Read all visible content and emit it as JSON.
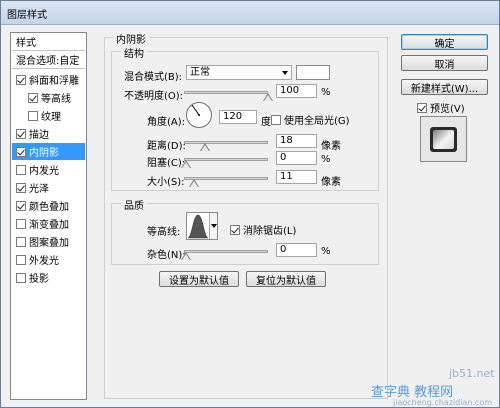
{
  "window": {
    "title": "图层样式"
  },
  "left_panel": {
    "header": "样式",
    "blend_options": "混合选项:自定",
    "items": [
      {
        "label": "斜面和浮雕",
        "checked": true,
        "indent": false,
        "selected": false
      },
      {
        "label": "等高线",
        "checked": true,
        "indent": true,
        "selected": false
      },
      {
        "label": "纹理",
        "checked": false,
        "indent": true,
        "selected": false
      },
      {
        "label": "描边",
        "checked": true,
        "indent": false,
        "selected": false
      },
      {
        "label": "内阴影",
        "checked": true,
        "indent": false,
        "selected": true
      },
      {
        "label": "内发光",
        "checked": false,
        "indent": false,
        "selected": false
      },
      {
        "label": "光泽",
        "checked": true,
        "indent": false,
        "selected": false
      },
      {
        "label": "颜色叠加",
        "checked": true,
        "indent": false,
        "selected": false
      },
      {
        "label": "渐变叠加",
        "checked": false,
        "indent": false,
        "selected": false
      },
      {
        "label": "图案叠加",
        "checked": false,
        "indent": false,
        "selected": false
      },
      {
        "label": "外发光",
        "checked": false,
        "indent": false,
        "selected": false
      },
      {
        "label": "投影",
        "checked": false,
        "indent": false,
        "selected": false
      }
    ]
  },
  "inner_shadow": {
    "title": "内阴影",
    "structure": {
      "title": "结构",
      "blend_mode_label": "混合模式(B):",
      "blend_mode_value": "正常",
      "opacity_label": "不透明度(O):",
      "opacity_value": "100",
      "opacity_unit": "%",
      "angle_label": "角度(A):",
      "angle_value": "120",
      "angle_unit": "度",
      "global_light_label": "使用全局光(G)",
      "global_light_checked": false,
      "distance_label": "距离(D):",
      "distance_value": "18",
      "distance_unit": "像素",
      "choke_label": "阻塞(C):",
      "choke_value": "0",
      "choke_unit": "%",
      "size_label": "大小(S):",
      "size_value": "11",
      "size_unit": "像素"
    },
    "quality": {
      "title": "品质",
      "contour_label": "等高线:",
      "anti_alias_label": "消除锯齿(L)",
      "anti_alias_checked": true,
      "noise_label": "杂色(N):",
      "noise_value": "0",
      "noise_unit": "%"
    },
    "set_default_label": "设置为默认值",
    "reset_default_label": "复位为默认值"
  },
  "buttons": {
    "ok": "确定",
    "cancel": "取消",
    "new_style": "新建样式(W)...",
    "preview_label": "预览(V)",
    "preview_checked": true
  },
  "watermark": {
    "line1": "jb51.net",
    "line2": "查字典 教程网",
    "line3": "jiaocheng.chazidian.com"
  }
}
